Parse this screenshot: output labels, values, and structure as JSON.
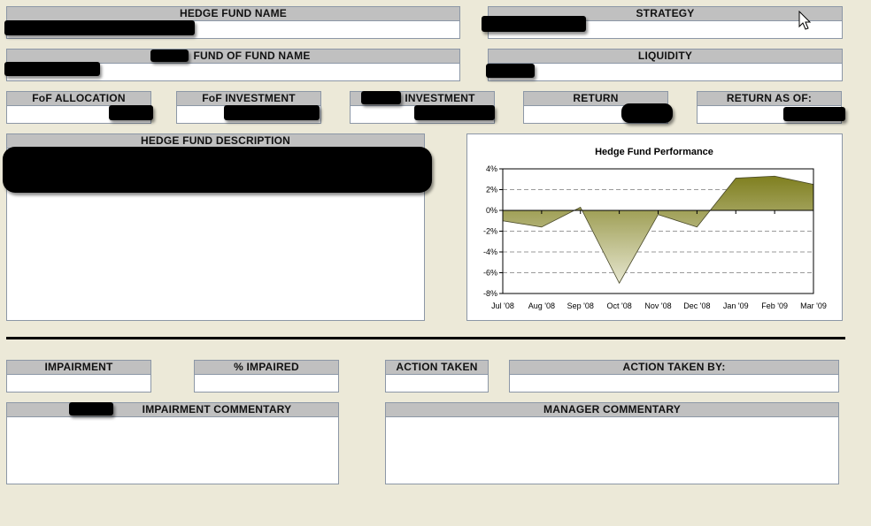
{
  "fields": {
    "hedge_fund_name": {
      "label": "HEDGE FUND NAME",
      "value": ""
    },
    "strategy": {
      "label": "STRATEGY",
      "value": ""
    },
    "fund_of_fund_name": {
      "label": "FUND OF FUND NAME",
      "value": ""
    },
    "liquidity": {
      "label": "LIQUIDITY",
      "value": ""
    },
    "fof_allocation": {
      "label": "FoF ALLOCATION",
      "value": ""
    },
    "fof_investment": {
      "label": "FoF INVESTMENT",
      "value": ""
    },
    "investment": {
      "label": "INVESTMENT",
      "value": ""
    },
    "return": {
      "label": "RETURN",
      "value": ""
    },
    "return_as_of": {
      "label": "RETURN AS OF:",
      "value": ""
    },
    "hedge_fund_description": {
      "label": "HEDGE FUND DESCRIPTION",
      "value": ""
    },
    "impairment": {
      "label": "IMPAIRMENT",
      "value": ""
    },
    "pct_impaired": {
      "label": "% IMPAIRED",
      "value": ""
    },
    "action_taken": {
      "label": "ACTION TAKEN",
      "value": ""
    },
    "action_taken_by": {
      "label": "ACTION TAKEN BY:",
      "value": ""
    },
    "impairment_commentary": {
      "label": "IMPAIRMENT COMMENTARY",
      "value": ""
    },
    "manager_commentary": {
      "label": "MANAGER COMMENTARY",
      "value": ""
    }
  },
  "chart_data": {
    "type": "area",
    "title": "Hedge Fund Performance",
    "categories": [
      "Jul '08",
      "Aug '08",
      "Sep '08",
      "Oct '08",
      "Nov '08",
      "Dec '08",
      "Jan '09",
      "Feb '09",
      "Mar '09"
    ],
    "values": [
      -1.0,
      -1.6,
      0.3,
      -7.0,
      -0.4,
      -1.6,
      3.1,
      3.3,
      2.5
    ],
    "xlabel": "",
    "ylabel": "",
    "ylim": [
      -8,
      4
    ],
    "yticks": [
      "4%",
      "2%",
      "0%",
      "-2%",
      "-4%",
      "-6%",
      "-8%"
    ],
    "grid": "dashed horizontal",
    "colors": {
      "fill_top": "#7f7f1f",
      "fill_bottom": "#e6e6cf",
      "line": "#4a4a2a"
    }
  },
  "colors": {
    "background": "#ece9d8",
    "header": "#c0c0c0",
    "border": "#8c97a6",
    "redaction": "#000000"
  },
  "icons": {
    "cursor": "mouse-pointer-icon"
  }
}
